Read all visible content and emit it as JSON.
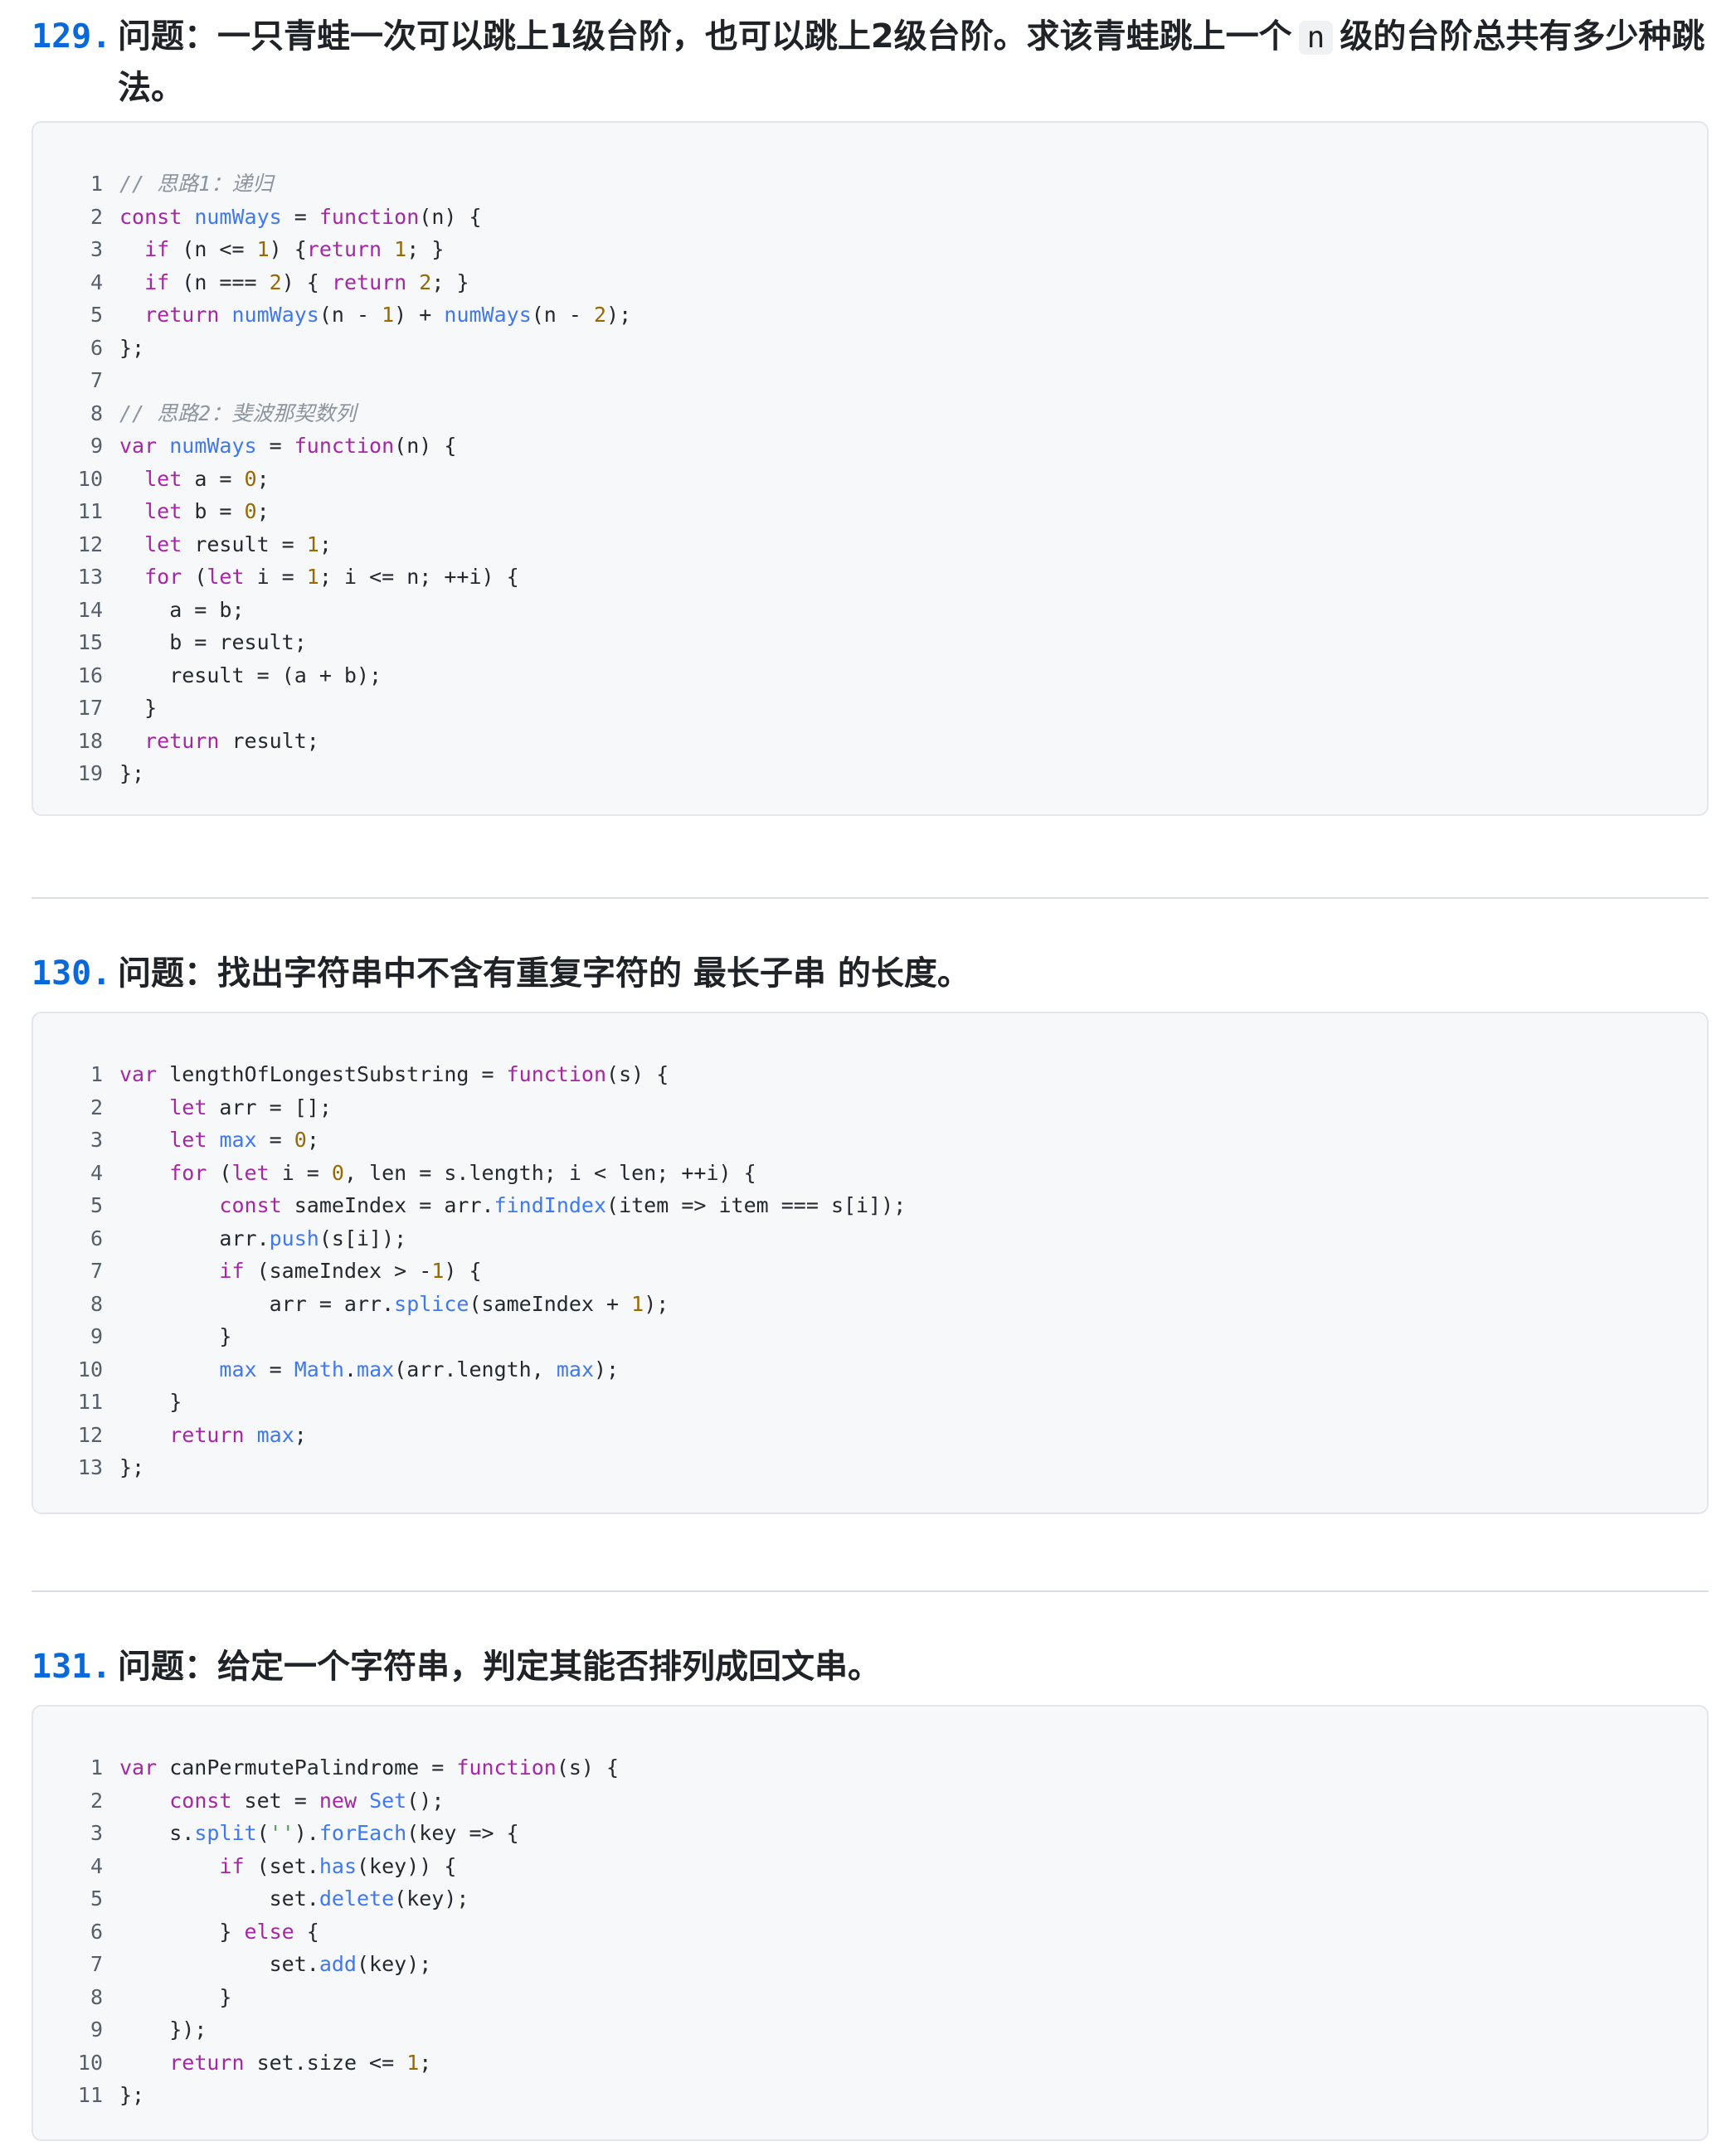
{
  "questions": [
    {
      "number": "129.",
      "title_before": "问题：一只青蛙一次可以跳上1级台阶，也可以跳上2级台阶。求该青蛙跳上一个",
      "title_code": "n",
      "title_after": "级的台阶总共有多少种跳法。",
      "code": [
        "// 思路1：递归",
        "const numWays = function(n) {",
        "  if (n <= 1) {return 1; }",
        "  if (n === 2) { return 2; }",
        "  return numWays(n - 1) + numWays(n - 2);",
        "};",
        "",
        "// 思路2：斐波那契数列",
        "var numWays = function(n) {",
        "  let a = 0;",
        "  let b = 0;",
        "  let result = 1;",
        "  for (let i = 1; i <= n; ++i) {",
        "    a = b;",
        "    b = result;",
        "    result = (a + b);",
        "  }",
        "  return result;",
        "};"
      ]
    },
    {
      "number": "130.",
      "title_before": "问题：找出字符串中不含有重复字符的 最长子串 的长度。",
      "title_code": "",
      "title_after": "",
      "code": [
        "var lengthOfLongestSubstring = function(s) {",
        "    let arr = [];",
        "    let max = 0;",
        "    for (let i = 0, len = s.length; i < len; ++i) {",
        "        const sameIndex = arr.findIndex(item => item === s[i]);",
        "        arr.push(s[i]);",
        "        if (sameIndex > -1) {",
        "            arr = arr.splice(sameIndex + 1);",
        "        }",
        "        max = Math.max(arr.length, max);",
        "    }",
        "    return max;",
        "};"
      ]
    },
    {
      "number": "131.",
      "title_before": "问题：给定一个字符串，判定其能否排列成回文串。",
      "title_code": "",
      "title_after": "",
      "code": [
        "var canPermutePalindrome = function(s) {",
        "    const set = new Set();",
        "    s.split('').forEach(key => {",
        "        if (set.has(key)) {",
        "            set.delete(key);",
        "        } else {",
        "            set.add(key);",
        "        }",
        "    });",
        "    return set.size <= 1;",
        "};"
      ]
    }
  ]
}
